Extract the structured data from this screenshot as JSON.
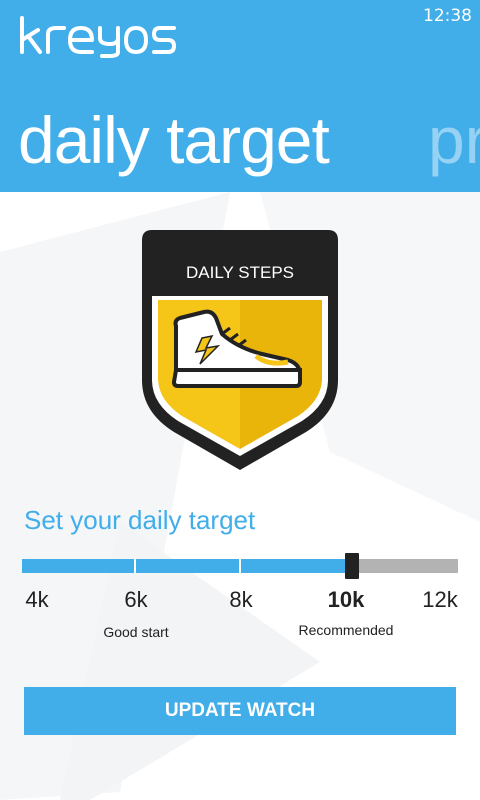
{
  "status_bar": {
    "time": "12:38"
  },
  "app": {
    "logo_text": "kreyos"
  },
  "pivot": {
    "current_title": "daily target",
    "next_title_peek": "pr"
  },
  "badge": {
    "label": "DAILY STEPS",
    "icon": "sneaker-icon"
  },
  "target": {
    "section_label": "Set your daily target",
    "selected_fraction": 0.75,
    "ticks": [
      {
        "label": "4k",
        "note": ""
      },
      {
        "label": "6k",
        "note": "Good start"
      },
      {
        "label": "8k",
        "note": ""
      },
      {
        "label": "10k",
        "note": "Recommended"
      },
      {
        "label": "12k",
        "note": ""
      }
    ]
  },
  "actions": {
    "update_label": "UPDATE WATCH"
  },
  "colors": {
    "accent": "#41ADE9",
    "badge_yellow": "#F5C518",
    "badge_dark": "#222222"
  }
}
